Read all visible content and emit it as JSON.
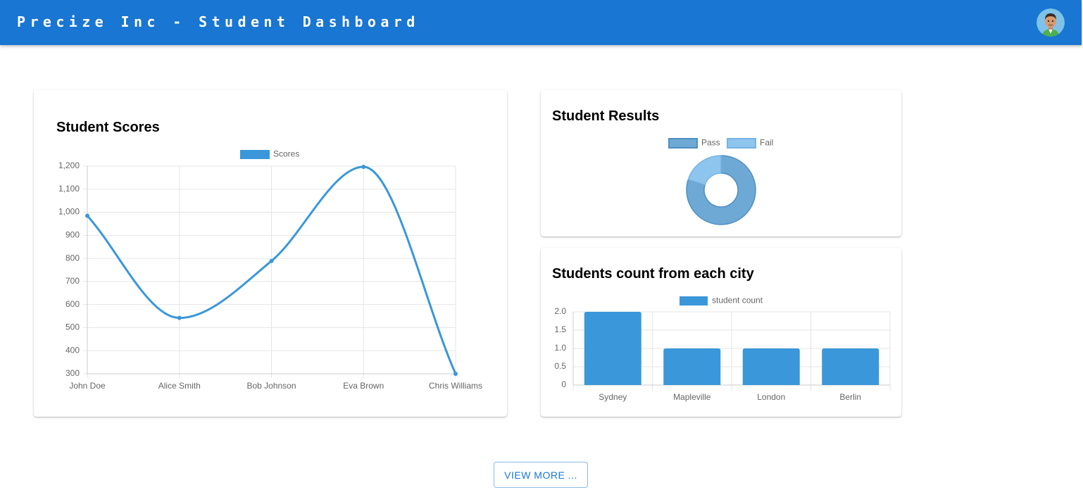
{
  "header": {
    "title": "Precize Inc - Student Dashboard",
    "avatar_icon": "user-avatar-icon"
  },
  "colors": {
    "appbar": "#1976d2",
    "line": "#3a97d9",
    "bar": "#3a97d9",
    "pass": "#6ea9d6",
    "fail": "#8ec5ee"
  },
  "scores_card": {
    "title": "Student Scores",
    "chart_data": {
      "type": "line",
      "categories": [
        "John Doe",
        "Alice Smith",
        "Bob Johnson",
        "Eva Brown",
        "Chris Williams"
      ],
      "series": [
        {
          "name": "Scores",
          "values": [
            985,
            542,
            789,
            1197,
            300
          ]
        }
      ],
      "ylim": [
        300,
        1200
      ],
      "yticks": [
        "1,200",
        "1,100",
        "1,000",
        "900",
        "800",
        "700",
        "600",
        "500",
        "400",
        "300"
      ],
      "grid": true,
      "legend": "top"
    }
  },
  "results_card": {
    "title": "Student Results",
    "chart_data": {
      "type": "pie",
      "labels": [
        "Pass",
        "Fail"
      ],
      "values": [
        80,
        20
      ],
      "legend": "top"
    }
  },
  "city_card": {
    "title": "Students count from each city",
    "chart_data": {
      "type": "bar",
      "categories": [
        "Sydney",
        "Mapleville",
        "London",
        "Berlin"
      ],
      "series": [
        {
          "name": "student count",
          "values": [
            2,
            1,
            1,
            1
          ]
        }
      ],
      "ylim": [
        0,
        2
      ],
      "yticks": [
        "2.0",
        "1.5",
        "1.0",
        "0.5",
        "0"
      ],
      "grid": true,
      "legend": "top"
    }
  },
  "actions": {
    "view_more_label": "VIEW MORE ..."
  }
}
